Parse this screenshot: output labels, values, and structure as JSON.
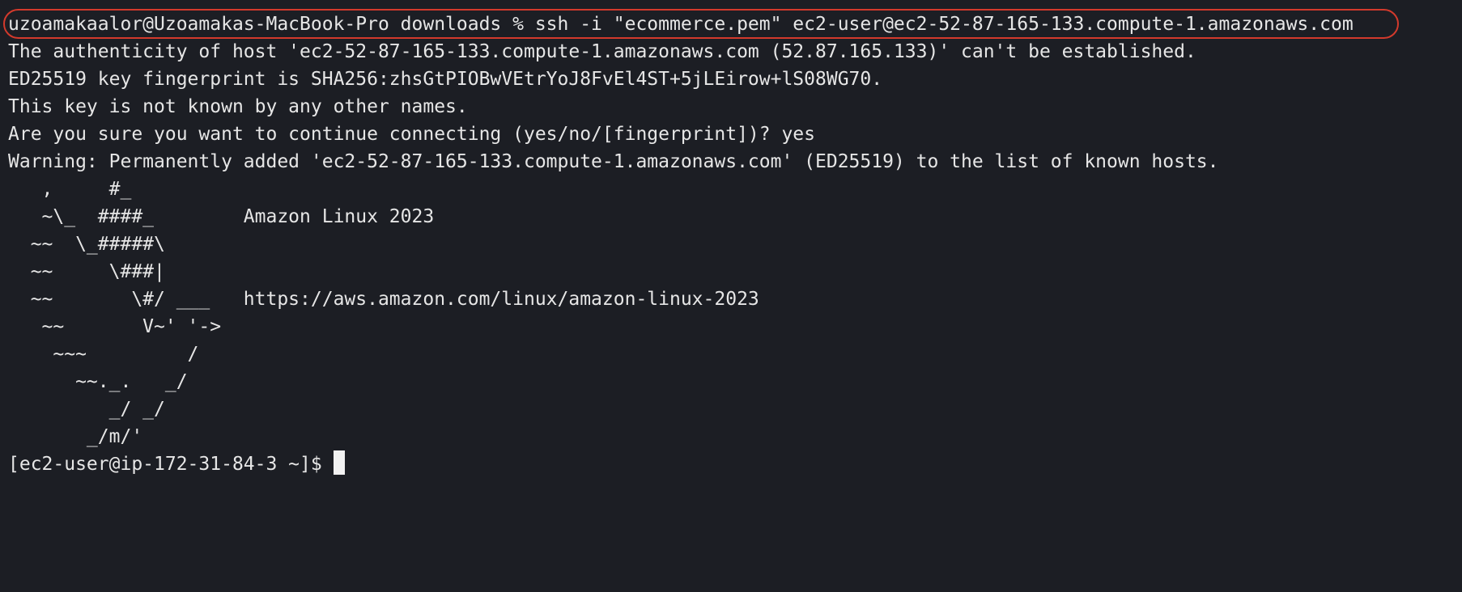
{
  "terminal": {
    "command_line": "uzoamakaalor@Uzoamakas-MacBook-Pro downloads % ssh -i \"ecommerce.pem\" ec2-user@ec2-52-87-165-133.compute-1.amazonaws.com",
    "output_lines": [
      "The authenticity of host 'ec2-52-87-165-133.compute-1.amazonaws.com (52.87.165.133)' can't be established.",
      "ED25519 key fingerprint is SHA256:zhsGtPIOBwVEtrYoJ8FvEl4ST+5jLEirow+lS08WG70.",
      "This key is not known by any other names.",
      "Are you sure you want to continue connecting (yes/no/[fingerprint])? yes",
      "Warning: Permanently added 'ec2-52-87-165-133.compute-1.amazonaws.com' (ED25519) to the list of known hosts."
    ],
    "banner": [
      "   ,     #_",
      "   ~\\_  ####_        Amazon Linux 2023",
      "  ~~  \\_#####\\",
      "  ~~     \\###|",
      "  ~~       \\#/ ___   https://aws.amazon.com/linux/amazon-linux-2023",
      "   ~~       V~' '->",
      "    ~~~         /",
      "      ~~._.   _/",
      "         _/ _/",
      "       _/m/'"
    ],
    "prompt": "[ec2-user@ip-172-31-84-3 ~]$ ",
    "highlight_color": "#d33a2c",
    "background_color": "#1c1e24",
    "text_color": "#e6e6e6"
  }
}
